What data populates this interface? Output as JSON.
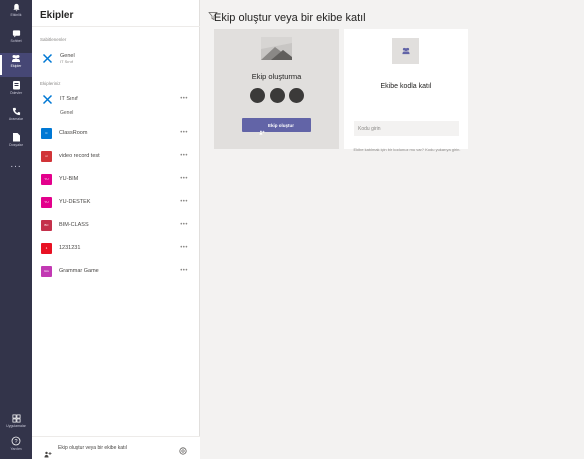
{
  "rail": {
    "items": [
      {
        "label": "Etkinlik",
        "icon": "bell-icon",
        "active": false
      },
      {
        "label": "Sohbet",
        "icon": "chat-icon",
        "active": false
      },
      {
        "label": "Ekipler",
        "icon": "teams-icon",
        "active": true
      },
      {
        "label": "Ödevler",
        "icon": "assignments-icon",
        "active": false
      },
      {
        "label": "Aramalar",
        "icon": "phone-icon",
        "active": false
      },
      {
        "label": "Dosyalar",
        "icon": "files-icon",
        "active": false
      }
    ],
    "more": "...",
    "bottom": [
      {
        "label": "Uygulamalar",
        "icon": "apps-icon"
      },
      {
        "label": "Yardım",
        "icon": "help-icon"
      }
    ]
  },
  "panel": {
    "title": "Ekipler",
    "favorites_label": "Sabitlenenler",
    "favorite": {
      "name": "Genel",
      "sub": "IT Sınıf"
    },
    "teams_label": "Ekipleriniz",
    "teams": [
      {
        "name": "IT Sınıf",
        "color": "#ffffff",
        "abbr": ""
      },
      {
        "name": "ClassRoom",
        "color": "#0078d4",
        "abbr": "C"
      },
      {
        "name": "video record test",
        "color": "#d13438",
        "abbr": "vr"
      },
      {
        "name": "YU-BIM",
        "color": "#e3008c",
        "abbr": "YU"
      },
      {
        "name": "YU-DESTEK",
        "color": "#e3008c",
        "abbr": "YU"
      },
      {
        "name": "BIM-CLASS",
        "color": "#c4314b",
        "abbr": "BC"
      },
      {
        "name": "1231231",
        "color": "#e81123",
        "abbr": "1"
      },
      {
        "name": "Grammar Game",
        "color": "#c239b3",
        "abbr": "GG"
      }
    ],
    "channel": "Genel",
    "footer": "Ekip oluştur veya bir ekibe katıl"
  },
  "main": {
    "title": "Ekip oluştur veya bir ekibe katıl",
    "create": {
      "heading": "Ekip oluşturma",
      "button": "Ekip oluştur"
    },
    "join": {
      "heading": "Ekibe kodla katıl",
      "placeholder": "Kodu girin",
      "help": "Ekibe katılmak için bir kodunuz mu var? Kodu yukarıya girin."
    }
  },
  "colors": {
    "rail": "#33344a",
    "accent": "#6264a7"
  }
}
